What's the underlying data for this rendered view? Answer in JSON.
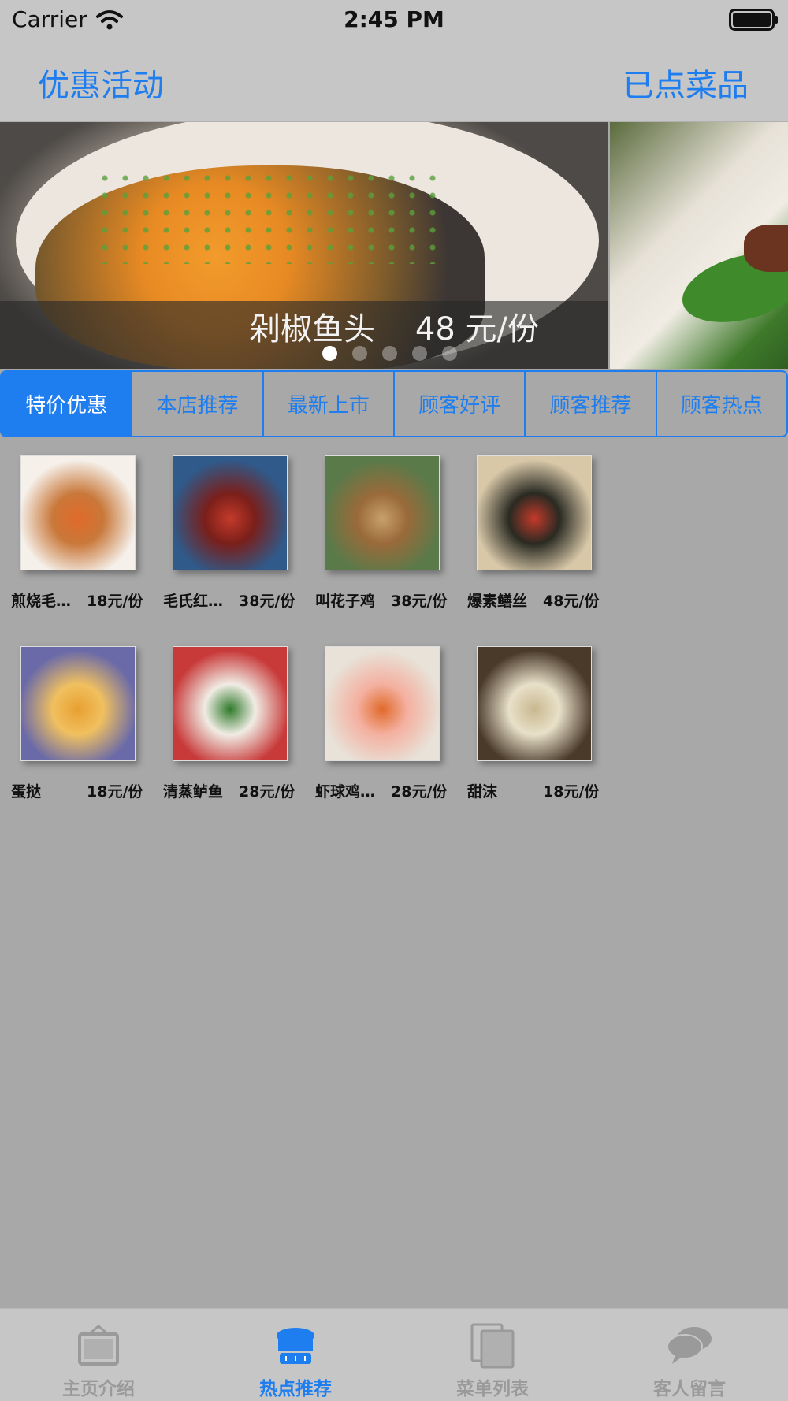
{
  "status_bar": {
    "carrier": "Carrier",
    "time": "2:45 PM"
  },
  "nav": {
    "left_label": "优惠活动",
    "right_label": "已点菜品"
  },
  "banner": {
    "dish_name": "剁椒鱼头",
    "price": "48 元/份",
    "page_count": 5,
    "current_page": 1
  },
  "segments": [
    {
      "label": "特价优惠",
      "selected": true
    },
    {
      "label": "本店推荐",
      "selected": false
    },
    {
      "label": "最新上市",
      "selected": false
    },
    {
      "label": "顾客好评",
      "selected": false
    },
    {
      "label": "顾客推荐",
      "selected": false
    },
    {
      "label": "顾客热点",
      "selected": false
    }
  ],
  "items": [
    {
      "name": "煎烧毛…",
      "price": "18元/份",
      "colors": [
        "#f5f0ea",
        "#c9783a",
        "#e06a2a"
      ]
    },
    {
      "name": "毛氏红…",
      "price": "38元/份",
      "colors": [
        "#2f5a8a",
        "#7a1f1a",
        "#c43a2a"
      ]
    },
    {
      "name": "叫花子鸡",
      "price": "38元/份",
      "colors": [
        "#5a7a4a",
        "#9a6a3a",
        "#c8a06a"
      ]
    },
    {
      "name": "爆素鳝丝",
      "price": "48元/份",
      "colors": [
        "#d8c8a8",
        "#2a2a22",
        "#c43a2a"
      ]
    },
    {
      "name": "蛋挞",
      "price": "18元/份",
      "colors": [
        "#6a6aa8",
        "#f0c060",
        "#e8a030"
      ]
    },
    {
      "name": "清蒸鲈鱼",
      "price": "28元/份",
      "colors": [
        "#c83a3a",
        "#f0ece4",
        "#2f7a2a"
      ]
    },
    {
      "name": "虾球鸡…",
      "price": "28元/份",
      "colors": [
        "#e8e2d8",
        "#f4b0a0",
        "#e06a2a"
      ]
    },
    {
      "name": "甜沫",
      "price": "18元/份",
      "colors": [
        "#4a3a2a",
        "#e8e0c8",
        "#c8b890"
      ]
    }
  ],
  "tabbar": [
    {
      "label": "主页介绍",
      "icon": "home-bag-icon",
      "active": false
    },
    {
      "label": "热点推荐",
      "icon": "chef-hat-icon",
      "active": true
    },
    {
      "label": "菜单列表",
      "icon": "menu-list-icon",
      "active": false
    },
    {
      "label": "客人留言",
      "icon": "chat-bubble-icon",
      "active": false
    }
  ],
  "colors": {
    "accent": "#1e7ef0",
    "background": "#a8a8a8",
    "bar": "#c6c6c6"
  }
}
